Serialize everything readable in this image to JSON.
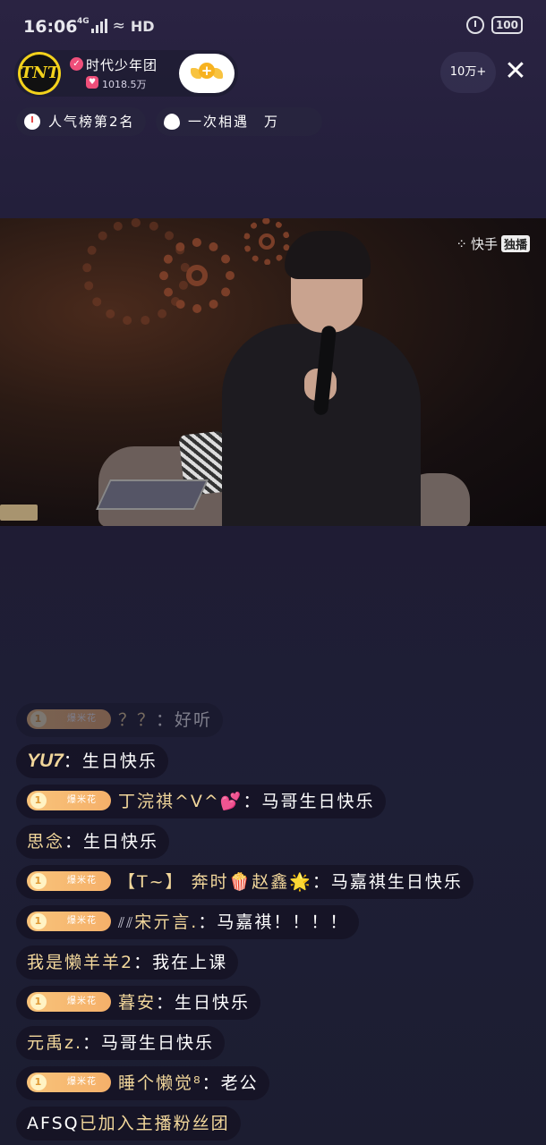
{
  "status_bar": {
    "time": "16:06",
    "network": "4G",
    "wifi_label": "HD",
    "battery": "100"
  },
  "host": {
    "avatar_text": "TNT",
    "name": "时代少年团",
    "fans": "1018.5万",
    "verified_icon": "check-icon",
    "fans_icon": "heart-icon"
  },
  "viewers": "10万+",
  "tags": [
    {
      "icon": "clock-icon",
      "label": "人气榜第2名"
    },
    {
      "icon": "flame-icon",
      "label": "一次相遇　万"
    }
  ],
  "video": {
    "watermark_app": "快手",
    "watermark_tag": "独播"
  },
  "chat": [
    {
      "badge": "爆米花",
      "badge_level": "1",
      "user": "？？",
      "text": "好听",
      "faded": true
    },
    {
      "badge": "",
      "user": "YU7",
      "text": "生日快乐"
    },
    {
      "badge": "爆米花",
      "badge_level": "1",
      "user": "丁浣祺^V^💕",
      "text": "马哥生日快乐"
    },
    {
      "badge": "",
      "user": "思念",
      "text": "生日快乐"
    },
    {
      "badge": "爆米花",
      "badge_level": "1",
      "user": "【T~】 奔时🍿赵鑫🌟",
      "text": "马嘉祺生日快乐"
    },
    {
      "badge": "爆米花",
      "badge_level": "1",
      "user": "宋亓言.",
      "text": "马嘉祺！！！！"
    },
    {
      "badge": "",
      "user": "我是懒羊羊2",
      "text": "我在上课"
    },
    {
      "badge": "爆米花",
      "badge_level": "1",
      "user": "暮安",
      "text": "生日快乐"
    },
    {
      "badge": "",
      "user": "元禹z.",
      "text": "马哥生日快乐"
    },
    {
      "badge": "爆米花",
      "badge_level": "1",
      "user": "睡个懒觉⁸",
      "text": "老公"
    },
    {
      "badge": "",
      "user": "AFSQ",
      "text": "已加入主播粉丝团"
    }
  ],
  "colors": {
    "username": "#f2d79b",
    "badge": "#f8c37a",
    "accent_pink": "#ef4f7a"
  }
}
